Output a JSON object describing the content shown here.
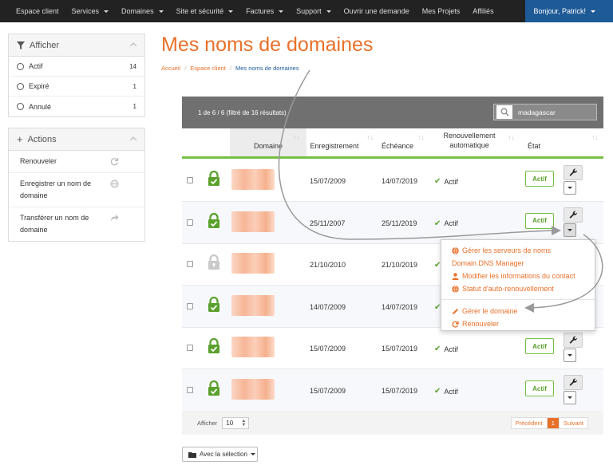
{
  "navbar": {
    "items": [
      {
        "label": "Espace client",
        "has_caret": false
      },
      {
        "label": "Services",
        "has_caret": true
      },
      {
        "label": "Domaines",
        "has_caret": true
      },
      {
        "label": "Site et sécurité",
        "has_caret": true
      },
      {
        "label": "Factures",
        "has_caret": true
      },
      {
        "label": "Support",
        "has_caret": true
      },
      {
        "label": "Ouvrir une demande",
        "has_caret": false
      },
      {
        "label": "Mes Projets",
        "has_caret": false
      },
      {
        "label": "Affiliés",
        "has_caret": false
      }
    ],
    "user": "Bonjour, Patrick!"
  },
  "filter_panel": {
    "title": "Afficher",
    "icon": "filter-icon",
    "items": [
      {
        "label": "Actif",
        "count": "14"
      },
      {
        "label": "Expiré",
        "count": "1"
      },
      {
        "label": "Annulé",
        "count": "1"
      }
    ]
  },
  "actions_panel": {
    "title": "Actions",
    "icon": "plus-icon",
    "items": [
      {
        "label": "Renouveler",
        "icon": "refresh-icon"
      },
      {
        "label": "Enregistrer un nom de domaine",
        "icon": "globe-icon"
      },
      {
        "label": "Transférer un nom de domaine",
        "icon": "share-arrow-icon"
      }
    ]
  },
  "page": {
    "title": "Mes noms de domaines",
    "breadcrumb": [
      "Accueil",
      "Espace client",
      "Mes noms de domaines"
    ]
  },
  "table": {
    "info": "1 de 6 / 6 (filtré de 16 résultats)",
    "search_value": "madagascar",
    "headers": {
      "domain": "Domaine",
      "registration": "Enregistrement",
      "expiry": "Échéance",
      "renew_line1": "Renouvellement",
      "renew_line2": "automatique",
      "status": "État"
    },
    "rows": [
      {
        "registered": "15/07/2009",
        "expires": "14/07/2019",
        "auto_renew": "Actif",
        "status": "Actif",
        "locked": true
      },
      {
        "registered": "25/11/2007",
        "expires": "25/11/2019",
        "auto_renew": "Actif",
        "status": "Actif",
        "locked": true
      },
      {
        "registered": "21/10/2010",
        "expires": "21/10/2019",
        "auto_renew": "Actif",
        "status": "Actif",
        "locked": false
      },
      {
        "registered": "14/07/2009",
        "expires": "14/07/2019",
        "auto_renew": "Actif",
        "status": "Actif",
        "locked": true
      },
      {
        "registered": "15/07/2009",
        "expires": "15/07/2019",
        "auto_renew": "Actif",
        "status": "Actif",
        "locked": true
      },
      {
        "registered": "15/07/2009",
        "expires": "15/07/2019",
        "auto_renew": "Actif",
        "status": "Actif",
        "locked": true
      }
    ],
    "footer": {
      "show_label": "Afficher",
      "page_size": "10",
      "prev": "Précédent",
      "current_page": "1",
      "next": "Suivant"
    },
    "bulk_button": "Avec la sélection"
  },
  "dropdown_menu": {
    "items": [
      {
        "label": "Gérer les serveurs de noms",
        "icon": "globe-icon"
      },
      {
        "label": "Domain DNS Manager",
        "icon": ""
      },
      {
        "label": "Modifier les informations du contact",
        "icon": "user-icon"
      },
      {
        "label": "Statut d'auto-renouvellement",
        "icon": "globe-icon"
      }
    ],
    "items2": [
      {
        "label": "Gérer le domaine",
        "icon": "pencil-icon"
      },
      {
        "label": "Renouveler",
        "icon": "refresh-icon"
      }
    ]
  },
  "colors": {
    "accent": "#e8702a",
    "navbar": "#222222",
    "user_nav": "#1e5a96",
    "success": "#75c043",
    "table_header_bar": "#707070"
  }
}
